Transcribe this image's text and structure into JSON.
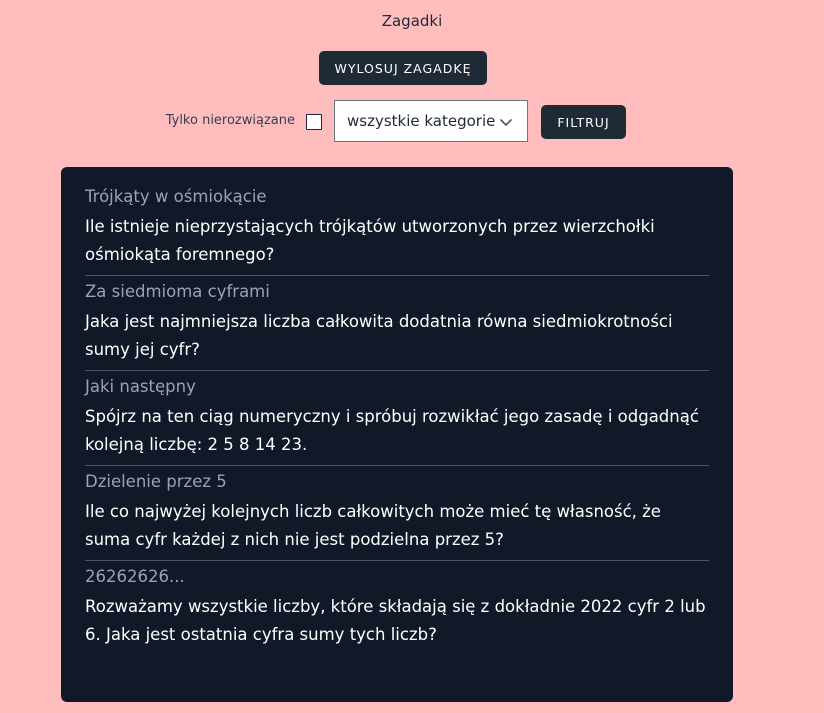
{
  "header": {
    "title": "Zagadki",
    "draw_button": "WYLOSUJ ZAGADKĘ"
  },
  "filters": {
    "unsolved_label": "Tylko nierozwiązane",
    "unsolved_checked": false,
    "category_selected": "wszystkie kategorie",
    "filter_button": "FILTRUJ"
  },
  "puzzles": [
    {
      "title": "Trójkąty w ośmiokącie",
      "text": "Ile istnieje nieprzystających trójkątów utworzonych przez wierzchołki ośmiokąta foremnego?"
    },
    {
      "title": "Za siedmioma cyframi",
      "text": "Jaka jest najmniejsza liczba całkowita dodatnia równa siedmiokrotności sumy jej cyfr?"
    },
    {
      "title": "Jaki następny",
      "text": "Spójrz na ten ciąg numeryczny i spróbuj rozwikłać jego zasadę i odgadnąć kolejną liczbę: 2 5 8 14 23."
    },
    {
      "title": "Dzielenie przez 5",
      "text": "Ile co najwyżej kolejnych liczb całkowitych może mieć tę własność, że suma cyfr każdej z nich nie jest podzielna przez 5?"
    },
    {
      "title": "26262626...",
      "text": "Rozważamy wszystkie liczby, które składają się z dokładnie 2022 cyfr 2 lub 6. Jaka jest ostatnia cyfra sumy tych liczb?"
    }
  ],
  "colors": {
    "page_background": "#ffbdbe",
    "panel_background": "#111827",
    "button_background": "#1f2a37",
    "puzzle_title": "#9ca3af",
    "puzzle_text": "#ffffff"
  }
}
